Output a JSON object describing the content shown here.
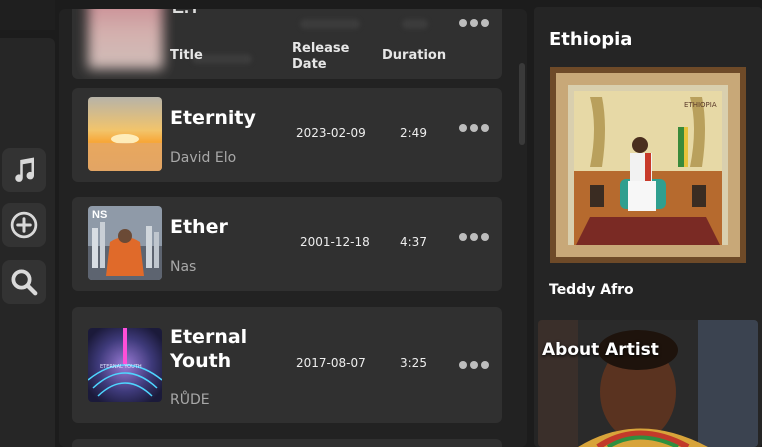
{
  "columns": {
    "title": "Title",
    "release_date": "Release Date",
    "duration": "Duration"
  },
  "partial_top_title": "E.T",
  "songs": [
    {
      "title": "Eternity",
      "artist": "David Elo",
      "release_date": "2023-02-09",
      "duration": "2:49",
      "thumb": "sunset"
    },
    {
      "title": "Ether",
      "artist": "Nas",
      "release_date": "2001-12-18",
      "duration": "4:37",
      "thumb": "nas-stillmatic"
    },
    {
      "title": "Eternal Youth",
      "artist": "RŮDE",
      "release_date": "2017-08-07",
      "duration": "3:25",
      "thumb": "neon-grid"
    }
  ],
  "sidebar": {
    "icons": [
      "music-note-icon",
      "add-circle-icon",
      "search-icon"
    ]
  },
  "right_panel": {
    "album_title": "Ethiopia",
    "artist": "Teddy Afro",
    "about_heading": "About Artist"
  },
  "colors": {
    "background": "#1c1c1c",
    "card": "#303030",
    "panel": "#222222",
    "accent_dots": "#bcbcbc"
  }
}
